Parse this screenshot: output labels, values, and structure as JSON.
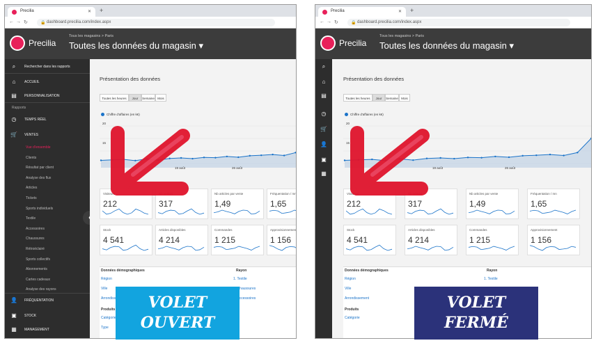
{
  "browser": {
    "tab_title": "Precilia",
    "url": "dashboard.precilia.com/index.aspx"
  },
  "app": {
    "brand": "Precilia",
    "store_subtitle": "Tous les magasins > Paris",
    "store_title": "Toutes les données du magasin ▾"
  },
  "sidebar": {
    "search": "Rechercher dans les rapports",
    "accueil": "ACCUEIL",
    "perso": "PERSONNALISATION",
    "rapports": "Rapports",
    "temps_reel": "TEMPS RÉEL",
    "ventes": "VENTES",
    "sub": [
      "Vue d'ensemble",
      "Clients",
      "Résultat par client",
      "Analyse des flux",
      "Articles",
      "Tickets",
      "Sports individuels",
      "Textile",
      "Accessoires",
      "Chaussures",
      "Rétroéclairé",
      "Sports collectifs",
      "Abonnements",
      "Cartes cadeaux",
      "Analyse des rayons"
    ],
    "frequentation": "FRÉQUENTATION",
    "stock": "STOCK",
    "management": "MANAGEMENT"
  },
  "main": {
    "title": "Présentation des données",
    "segments": [
      "Toutes les heures",
      "Jour",
      "Semaine",
      "Mois"
    ],
    "active_segment": "Jour",
    "legend": "Chiffre d'affaires (en k€)",
    "y_labels": [
      "20",
      "15"
    ],
    "x_labels": [
      "19 août",
      "26 août"
    ],
    "kpis_row1": [
      {
        "label": "Visiteurs",
        "value": "212"
      },
      {
        "label": "Nb ventes",
        "value": "317"
      },
      {
        "label": "Nb articles par vente",
        "value": "1,49"
      },
      {
        "label": "Fréquentation / mn",
        "value": "1,65"
      }
    ],
    "kpis_row2": [
      {
        "label": "Stock",
        "value": "4 541"
      },
      {
        "label": "Articles disponibles",
        "value": "4 214"
      },
      {
        "label": "Commandes",
        "value": "1 215"
      },
      {
        "label": "Approvisionnement",
        "value": "1 156"
      }
    ],
    "demo": {
      "header": "Données démographiques",
      "links": [
        "Région",
        "Ville",
        "Arrondissement"
      ],
      "rayon_header": "Rayon",
      "rayons": [
        "1. Textile",
        "2. Chaussures",
        "3. Accessoires"
      ],
      "produits": "Produits",
      "categorie": "Catégorie",
      "type": "Type"
    }
  },
  "badges": {
    "left": [
      "VOLET",
      "OUVERT"
    ],
    "right": [
      "VOLET",
      "FERMÉ"
    ]
  },
  "colors": {
    "accent": "#e8205a",
    "chart_line": "#1a73c9",
    "chart_fill": "#b9cde3",
    "badge_left": "#12a4df",
    "badge_right": "#2b327a",
    "arrow": "#e0142c"
  }
}
